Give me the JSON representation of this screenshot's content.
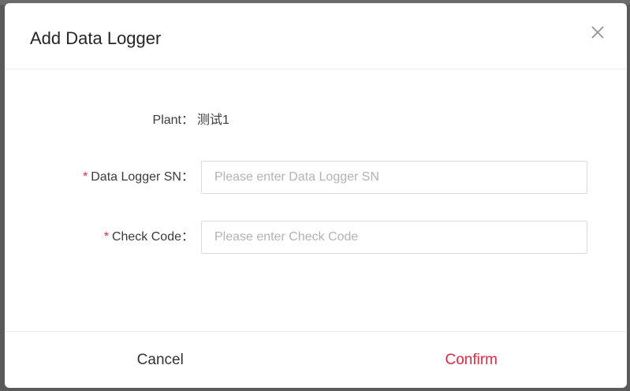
{
  "dialog": {
    "title": "Add Data Logger",
    "close_icon": "close-icon"
  },
  "form": {
    "plant": {
      "label": "Plant：",
      "value": "测试1"
    },
    "logger_sn": {
      "required_mark": "*",
      "label": "Data Logger SN：",
      "value": "",
      "placeholder": "Please enter Data Logger SN"
    },
    "check_code": {
      "required_mark": "*",
      "label": "Check Code：",
      "value": "",
      "placeholder": "Please enter Check Code"
    }
  },
  "footer": {
    "cancel_label": "Cancel",
    "confirm_label": "Confirm"
  },
  "colors": {
    "accent": "#e2293f",
    "text": "#3b3b3b",
    "placeholder": "#b3b3b3",
    "border": "#d9d9d9"
  }
}
